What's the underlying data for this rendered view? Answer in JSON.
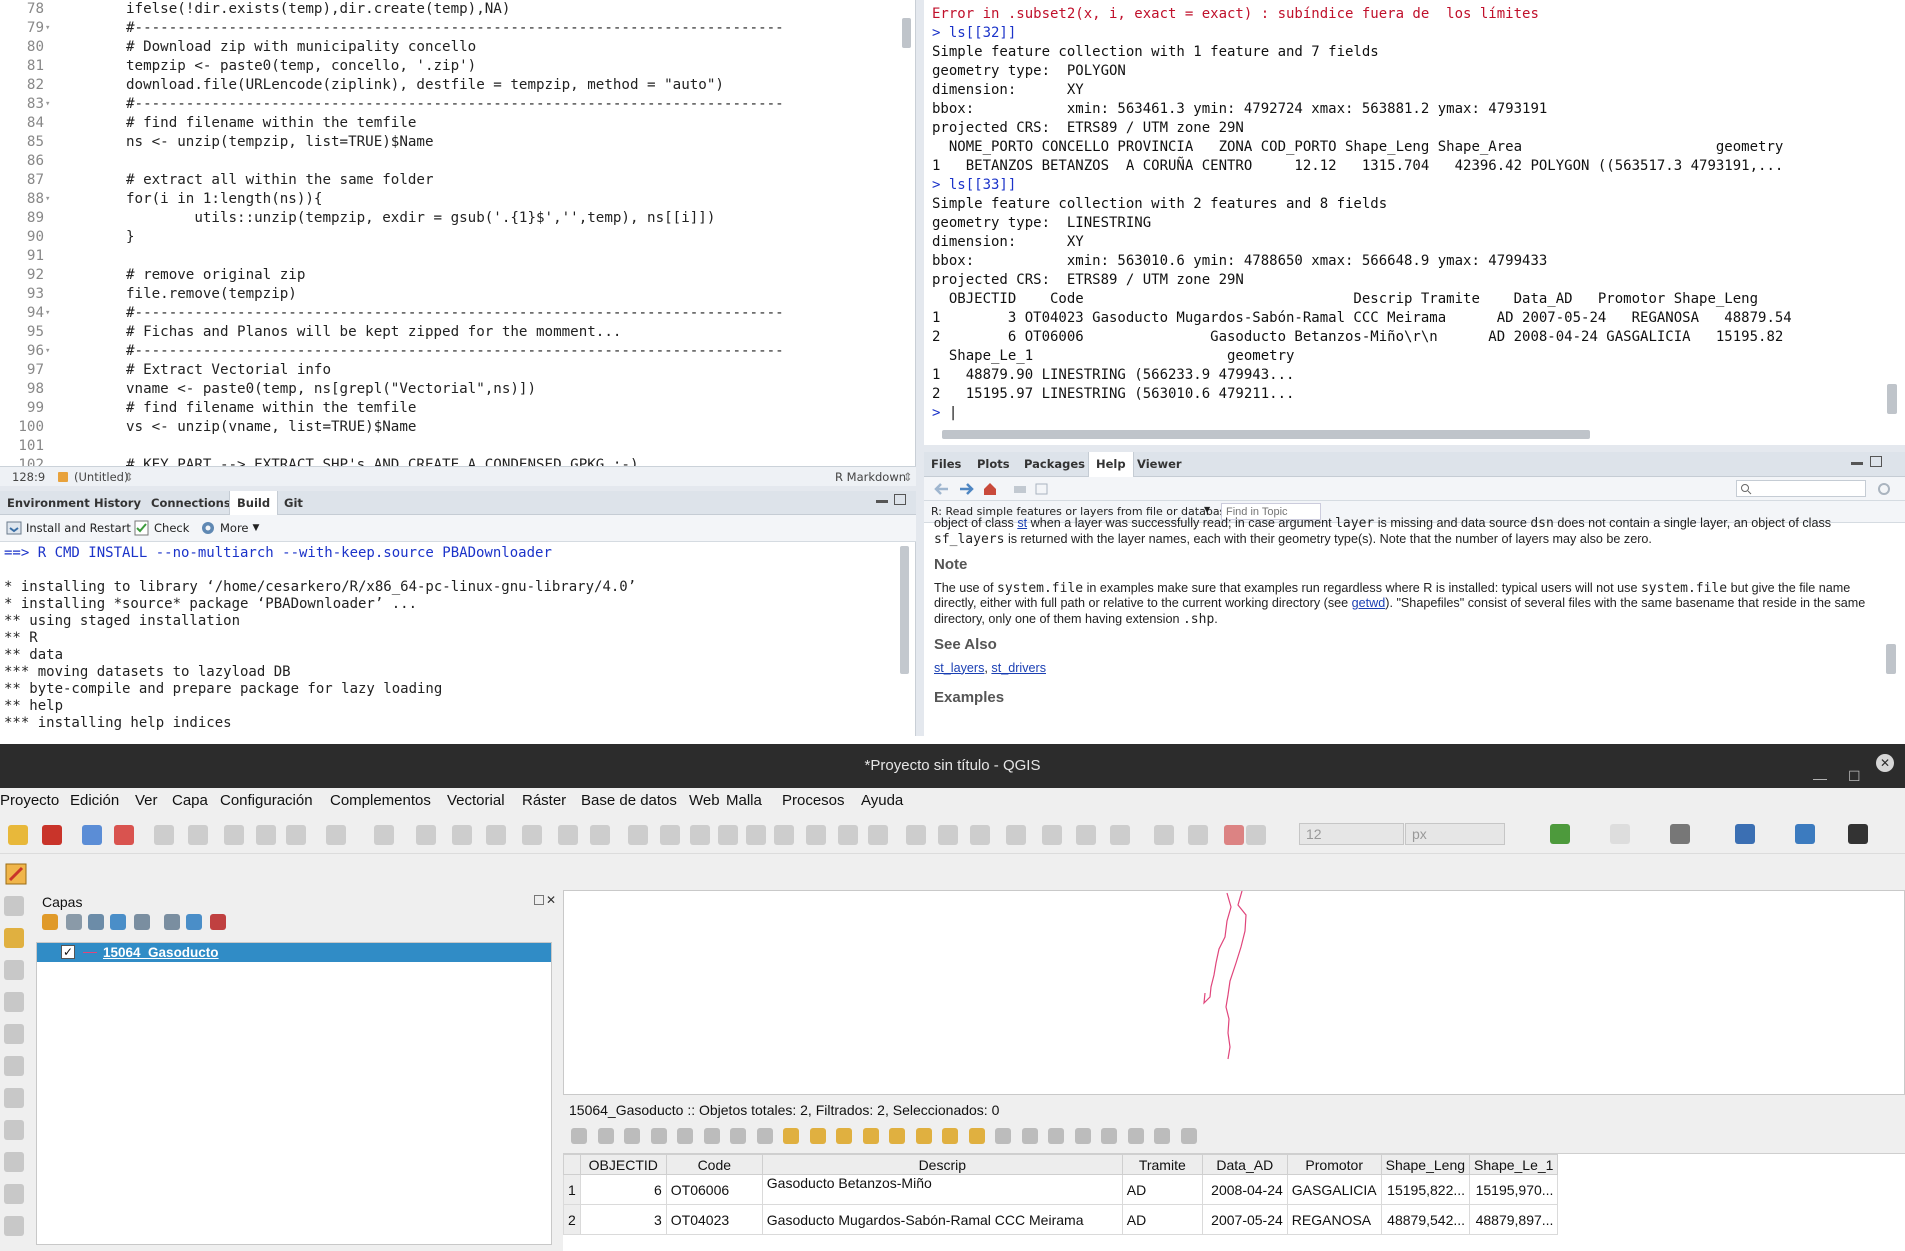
{
  "editor": {
    "lines": [
      {
        "n": "78",
        "t": "ifelse(!dir.exists(temp),dir.create(temp),NA)"
      },
      {
        "n": "79",
        "t": "#----------------------------------------------------------------------------",
        "cls": "c-dash",
        "fold": true
      },
      {
        "n": "80",
        "t": "# Download zip with municipality concello",
        "cls": "c-com"
      },
      {
        "n": "81",
        "t": "tempzip <- paste0(temp, concello, '.zip')"
      },
      {
        "n": "82",
        "t": "download.file(URLencode(ziplink), destfile = tempzip, method = \"auto\")"
      },
      {
        "n": "83",
        "t": "#----------------------------------------------------------------------------",
        "cls": "c-dash",
        "fold": true
      },
      {
        "n": "84",
        "t": "# find filename within the temfile",
        "cls": "c-com"
      },
      {
        "n": "85",
        "t": "ns <- unzip(tempzip, list=TRUE)$Name"
      },
      {
        "n": "86",
        "t": ""
      },
      {
        "n": "87",
        "t": "# extract all within the same folder",
        "cls": "c-com"
      },
      {
        "n": "88",
        "t": "for(i in 1:length(ns)){",
        "fold": true
      },
      {
        "n": "89",
        "t": "        utils::unzip(tempzip, exdir = gsub('.{1}$','',temp), ns[[i]])"
      },
      {
        "n": "90",
        "t": "}"
      },
      {
        "n": "91",
        "t": ""
      },
      {
        "n": "92",
        "t": "# remove original zip",
        "cls": "c-com"
      },
      {
        "n": "93",
        "t": "file.remove(tempzip)"
      },
      {
        "n": "94",
        "t": "#----------------------------------------------------------------------------",
        "cls": "c-dash",
        "fold": true
      },
      {
        "n": "95",
        "t": "# Fichas and Planos will be kept zipped for the momment...",
        "cls": "c-com"
      },
      {
        "n": "96",
        "t": "#----------------------------------------------------------------------------",
        "cls": "c-dash",
        "fold": true
      },
      {
        "n": "97",
        "t": "# Extract Vectorial info",
        "cls": "c-com"
      },
      {
        "n": "98",
        "t": "vname <- paste0(temp, ns[grepl(\"Vectorial\",ns)])"
      },
      {
        "n": "99",
        "t": "# find filename within the temfile",
        "cls": "c-com"
      },
      {
        "n": "100",
        "t": "vs <- unzip(vname, list=TRUE)$Name"
      },
      {
        "n": "101",
        "t": ""
      },
      {
        "n": "102",
        "t": "# KEY PART --> EXTRACT SHP's AND CREATE A CONDENSED GPKG :-)",
        "cls": "c-com"
      }
    ],
    "status": {
      "pos": "128:9",
      "file": "(Untitled)",
      "mode": "R Markdown"
    }
  },
  "build": {
    "tabs": [
      "Environment",
      "History",
      "Connections",
      "Build",
      "Git"
    ],
    "active_tab": "Build",
    "install_label": "Install and Restart",
    "check_label": "Check",
    "more_label": "More",
    "output": [
      "==> R CMD INSTALL --no-multiarch --with-keep.source PBADownloader",
      "",
      "* installing to library ‘/home/cesarkero/R/x86_64-pc-linux-gnu-library/4.0’",
      "* installing *source* package ‘PBADownloader’ ...",
      "** using staged installation",
      "** R",
      "** data",
      "*** moving datasets to lazyload DB",
      "** byte-compile and prepare package for lazy loading",
      "** help",
      "*** installing help indices"
    ]
  },
  "console": {
    "lines": [
      {
        "t": "Error in .subset2(x, i, exact = exact) : subíndice fuera de  los límites",
        "cls": "err"
      },
      {
        "t": "> ls[[32]]",
        "cls": "prompt"
      },
      {
        "t": "Simple feature collection with 1 feature and 7 fields"
      },
      {
        "t": "geometry type:  POLYGON"
      },
      {
        "t": "dimension:      XY"
      },
      {
        "t": "bbox:           xmin: 563461.3 ymin: 4792724 xmax: 563881.2 ymax: 4793191"
      },
      {
        "t": "projected CRS:  ETRS89 / UTM zone 29N"
      },
      {
        "t": "  NOME_PORTO CONCELLO PROVINCIA   ZONA COD_PORTO Shape_Leng Shape_Area                       geometry"
      },
      {
        "t": "1   BETANZOS BETANZOS  A CORUÑA CENTRO     12.12   1315.704   42396.42 POLYGON ((563517.3 4793191,..."
      },
      {
        "t": "> ls[[33]]",
        "cls": "prompt"
      },
      {
        "t": "Simple feature collection with 2 features and 8 fields"
      },
      {
        "t": "geometry type:  LINESTRING"
      },
      {
        "t": "dimension:      XY"
      },
      {
        "t": "bbox:           xmin: 563010.6 ymin: 4788650 xmax: 566648.9 ymax: 4799433"
      },
      {
        "t": "projected CRS:  ETRS89 / UTM zone 29N"
      },
      {
        "t": "  OBJECTID    Code                                Descrip Tramite    Data_AD   Promotor Shape_Leng"
      },
      {
        "t": "1        3 OT04023 Gasoducto Mugardos-Sabón-Ramal CCC Meirama      AD 2007-05-24   REGANOSA   48879.54"
      },
      {
        "t": "2        6 OT06006               Gasoducto Betanzos-Miño\\r\\n      AD 2008-04-24 GASGALICIA   15195.82"
      },
      {
        "t": "  Shape_Le_1                       geometry"
      },
      {
        "t": "1   48879.90 LINESTRING (566233.9 479943..."
      },
      {
        "t": "2   15195.97 LINESTRING (563010.6 479211..."
      },
      {
        "t": "> ",
        "cls": "prompt"
      }
    ]
  },
  "help": {
    "tabs": [
      "Files",
      "Plots",
      "Packages",
      "Help",
      "Viewer"
    ],
    "active_tab": "Help",
    "topic": "R: Read simple features or layers from file or database",
    "find_placeholder": "Find in Topic",
    "intro_a": "object of class ",
    "intro_link": "st",
    "intro_b": " when a layer was successfully read; in case argument ",
    "intro_code1": "layer",
    "intro_c": " is missing and data source ",
    "intro_code2": "dsn",
    "intro_d": " does not contain a single layer, an object of class ",
    "intro_code3": "sf_layers",
    "intro_e": " is returned with the layer names, each with their geometry type(s). Note that the number of layers may also be zero.",
    "note_heading": "Note",
    "note_a": "The use of ",
    "note_code1": "system.file",
    "note_b": " in examples make sure that examples run regardless where R is installed: typical users will not use ",
    "note_code2": "system.file",
    "note_c": " but give the file name directly, either with full path or relative to the current working directory (see ",
    "note_link": "getwd",
    "note_d": "). \"Shapefiles\" consist of several files with the same basename that reside in the same directory, only one of them having extension ",
    "note_code3": ".shp",
    "note_e": ".",
    "seealso_heading": "See Also",
    "seealso_link1": "st_layers",
    "seealso_sep": ", ",
    "seealso_link2": "st_drivers",
    "examples_heading": "Examples"
  },
  "qgis": {
    "title": "*Proyecto sin título - QGIS",
    "menu": [
      "Proyecto",
      "Edición",
      "Ver",
      "Capa",
      "Configuración",
      "Complementos",
      "Vectorial",
      "Ráster",
      "Base de datos",
      "Web",
      "Malla",
      "Procesos",
      "Ayuda"
    ],
    "font_size_value": "12",
    "unit_value": "px",
    "layers_title": "Capas",
    "layer_name": "15064_Gasoducto",
    "attr_title": "15064_Gasoducto :: Objetos totales: 2, Filtrados: 2, Seleccionados: 0",
    "attr_columns": [
      "OBJECTID",
      "Code",
      "Descrip",
      "Tramite",
      "Data_AD",
      "Promotor",
      "Shape_Leng",
      "Shape_Le_1"
    ],
    "attr_rows": [
      {
        "rownum": "1",
        "cells": [
          "6",
          "OT06006",
          "Gasoducto Betanzos-Miño",
          "AD",
          "2008-04-24",
          "GASGALICIA",
          "15195,822...",
          "15195,970..."
        ]
      },
      {
        "rownum": "2",
        "cells": [
          "3",
          "OT04023",
          "Gasoducto Mugardos-Sabón-Ramal CCC Meirama",
          "AD",
          "2007-05-24",
          "REGANOSA",
          "48879,542...",
          "48879,897..."
        ]
      }
    ],
    "map_line_color": "#e0457b"
  }
}
